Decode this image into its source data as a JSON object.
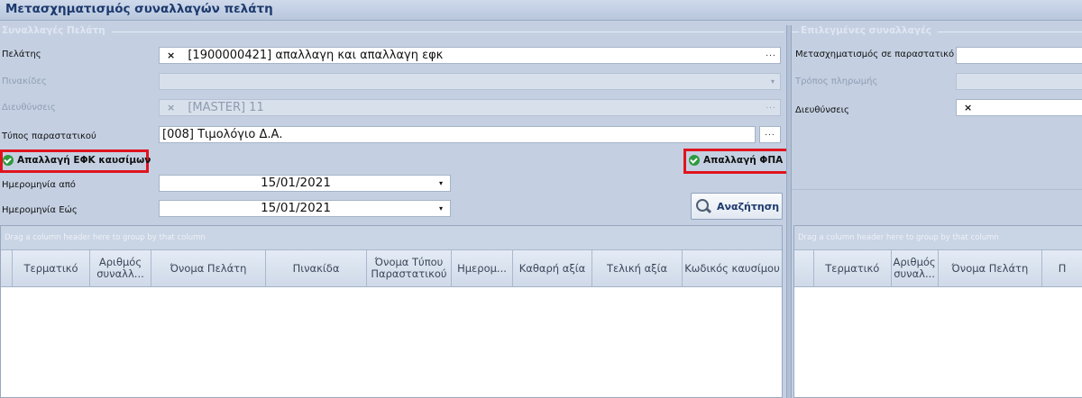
{
  "window": {
    "title": "Μετασχηματισμός συναλλαγών πελάτη"
  },
  "left": {
    "group_title": "Συναλλαγές Πελάτη",
    "customer": {
      "label": "Πελάτης",
      "value": "[1900000421] απαλλαγη και απαλλαγη εφκ",
      "clear_glyph": "×",
      "ellipsis": "..."
    },
    "plates": {
      "label": "Πινακίδες",
      "value": "",
      "caret": "▾"
    },
    "addresses": {
      "label": "Διευθύνσεις",
      "value": "[MASTER] 11",
      "clear_glyph": "×",
      "ellipsis": "..."
    },
    "doc_type": {
      "label": "Τύπος παραστατικού",
      "value": "[008] Τιμολόγιο Δ.Α.",
      "ellipsis": "..."
    },
    "efk_exempt": {
      "label": "Απαλλαγή ΕΦΚ καυσίμων",
      "checked": true
    },
    "vat_exempt": {
      "label": "Απαλλαγή ΦΠΑ",
      "checked": true
    },
    "date_from": {
      "label": "Ημερομηνία από",
      "value": "15/01/2021",
      "caret": "▾"
    },
    "date_to": {
      "label": "Ημερομηνία Εώς",
      "value": "15/01/2021",
      "caret": "▾"
    },
    "search_button": {
      "label": "Αναζήτηση",
      "icon": "magnifier-icon"
    },
    "grid": {
      "group_hint": "Drag a column header here to group by that column",
      "columns": [
        "",
        "Τερματικό",
        "Αριθμός συναλλ...",
        "Όνομα Πελάτη",
        "Πινακίδα",
        "Όνομα Τύπου Παραστατικού",
        "Ημερομ...",
        "Καθαρή αξία",
        "Τελική αξία",
        "Κωδικός καυσίμου"
      ]
    }
  },
  "right": {
    "group_title": "Επιλεγμένες συναλλαγές",
    "transform_to": {
      "label": "Μετασχηματισμός σε παραστατικό",
      "value": ""
    },
    "payment_method": {
      "label": "Τρόπος πληρωμής",
      "value": ""
    },
    "addresses": {
      "label": "Διευθύνσεις",
      "value": "",
      "clear_glyph": "×"
    },
    "grid": {
      "group_hint": "Drag a column header here to group by that column",
      "columns": [
        "",
        "Τερματικό",
        "Αριθμός συναλ...",
        "Όνομα Πελάτη",
        "Π"
      ]
    }
  },
  "colors": {
    "highlight": "#e0141e",
    "check": "#2f9a3f",
    "title": "#1d3a6e",
    "background": "#c4d0e2"
  }
}
